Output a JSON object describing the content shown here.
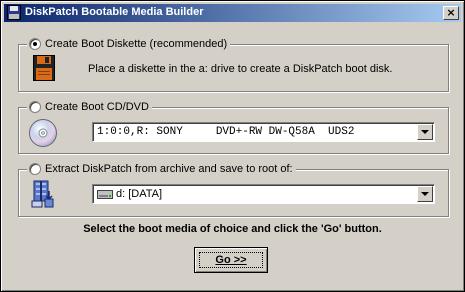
{
  "window": {
    "title": "DiskPatch Bootable Media Builder"
  },
  "icons": {
    "app": "floppy-disk-icon",
    "diskette": "diskette-icon",
    "cd": "cd-disc-icon",
    "archive": "archive-extract-icon",
    "drive": "hard-drive-icon",
    "close": "close-icon"
  },
  "options": {
    "diskette": {
      "label": "Create Boot Diskette (recommended)",
      "selected": true,
      "description": "Place a diskette in the a: drive to create a DiskPatch boot disk."
    },
    "cd": {
      "label": "Create Boot CD/DVD",
      "selected": false,
      "drive_value": "1:0:0,R: SONY     DVD+-RW DW-Q58A  UDS2"
    },
    "archive": {
      "label": "Extract DiskPatch from archive and save to root of:",
      "selected": false,
      "drive_value": "d: [DATA]"
    }
  },
  "instruction": "Select the boot media of choice and click the 'Go' button.",
  "go_button": "Go >>",
  "colors": {
    "titlebar_start": "#0a246a",
    "titlebar_end": "#a6caf0",
    "face": "#d4d0c8",
    "diskette_body": "#d86b1a"
  }
}
